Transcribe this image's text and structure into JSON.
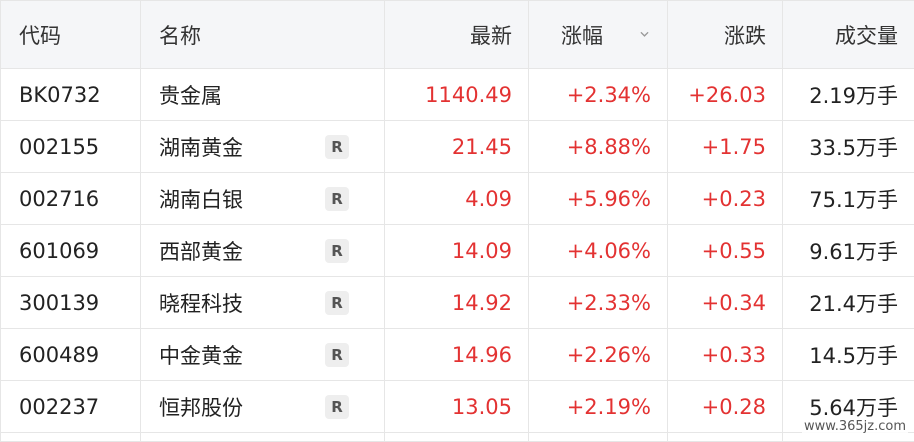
{
  "headers": {
    "code": "代码",
    "name": "名称",
    "last": "最新",
    "pct": "涨幅",
    "chg": "涨跌",
    "vol": "成交量"
  },
  "rows": [
    {
      "code": "BK0732",
      "name": "贵金属",
      "badge": "",
      "last": "1140.49",
      "pct": "+2.34%",
      "chg": "+26.03",
      "vol": "2.19万手"
    },
    {
      "code": "002155",
      "name": "湖南黄金",
      "badge": "R",
      "last": "21.45",
      "pct": "+8.88%",
      "chg": "+1.75",
      "vol": "33.5万手"
    },
    {
      "code": "002716",
      "name": "湖南白银",
      "badge": "R",
      "last": "4.09",
      "pct": "+5.96%",
      "chg": "+0.23",
      "vol": "75.1万手"
    },
    {
      "code": "601069",
      "name": "西部黄金",
      "badge": "R",
      "last": "14.09",
      "pct": "+4.06%",
      "chg": "+0.55",
      "vol": "9.61万手"
    },
    {
      "code": "300139",
      "name": "晓程科技",
      "badge": "R",
      "last": "14.92",
      "pct": "+2.33%",
      "chg": "+0.34",
      "vol": "21.4万手"
    },
    {
      "code": "600489",
      "name": "中金黄金",
      "badge": "R",
      "last": "14.96",
      "pct": "+2.26%",
      "chg": "+0.33",
      "vol": "14.5万手"
    },
    {
      "code": "002237",
      "name": "恒邦股份",
      "badge": "R",
      "last": "13.05",
      "pct": "+2.19%",
      "chg": "+0.28",
      "vol": "5.64万手"
    }
  ],
  "watermark": "www.365jz.com",
  "colors": {
    "up": "#e33232",
    "header_bg": "#f5f6f8",
    "border": "#e6e6e6"
  }
}
